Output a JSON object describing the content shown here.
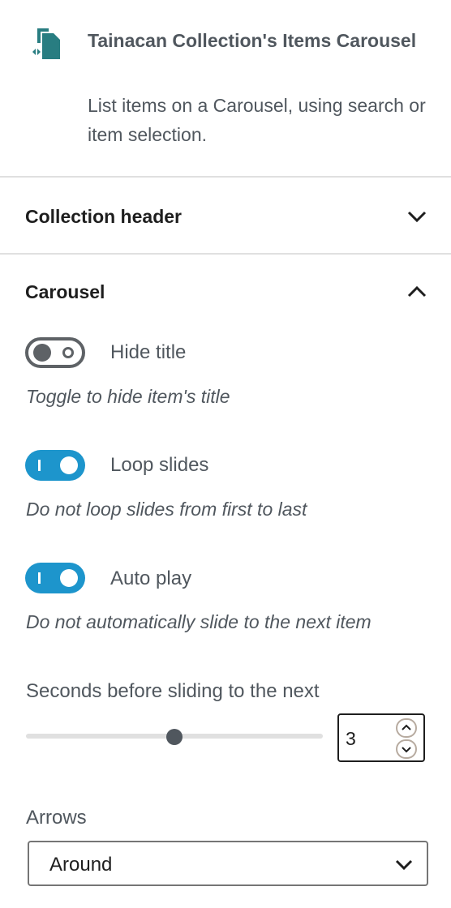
{
  "block": {
    "icon": "carousel-block-icon",
    "title": "Tainacan Collection's Items Carousel",
    "description": "List items on a Carousel, using search or item selection."
  },
  "panels": {
    "collection_header": {
      "title": "Collection header",
      "icon": "chevron-down-icon"
    },
    "carousel": {
      "title": "Carousel",
      "icon": "chevron-up-icon"
    }
  },
  "settings": {
    "hide_title": {
      "label": "Hide title",
      "help": "Toggle to hide item's title",
      "checked": false
    },
    "loop_slides": {
      "label": "Loop slides",
      "help": "Do not loop slides from first to last",
      "checked": true
    },
    "auto_play": {
      "label": "Auto play",
      "help": "Do not automatically slide to the next item",
      "checked": true
    },
    "seconds": {
      "label": "Seconds before sliding to the next",
      "value": "3",
      "slider_fraction": 0.5
    },
    "arrows": {
      "label": "Arrows",
      "selected": "Around"
    }
  },
  "colors": {
    "accent": "#1d95cc",
    "icon_teal": "#287d81",
    "text_muted": "#50575e"
  }
}
